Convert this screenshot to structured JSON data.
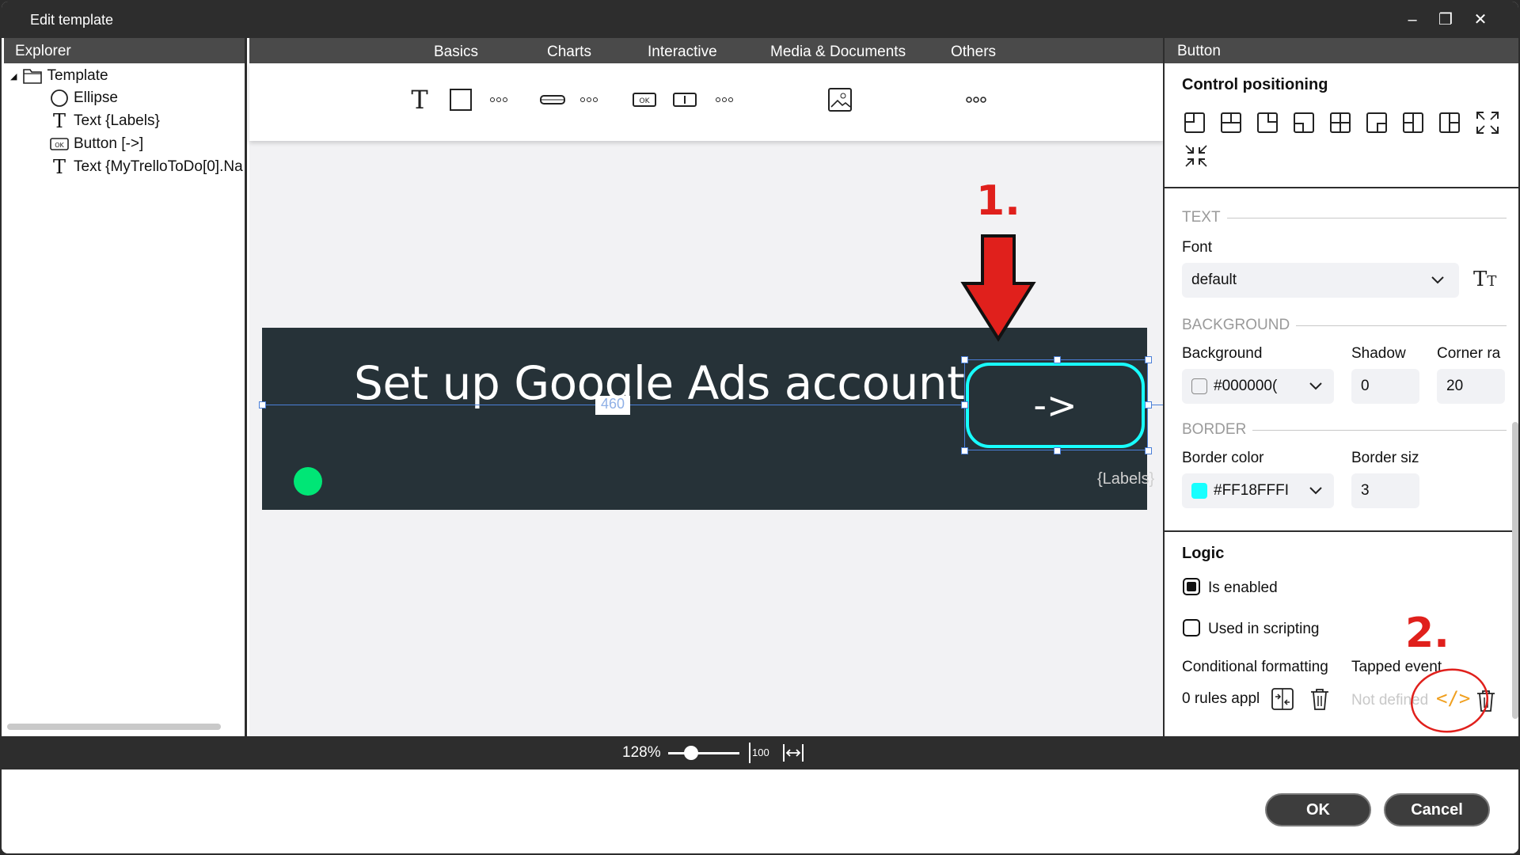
{
  "window": {
    "title": "Edit template",
    "minimize_icon": "minimize-icon",
    "restore_icon": "restore-icon",
    "close_icon": "close-icon"
  },
  "explorer": {
    "header": "Explorer",
    "items": [
      {
        "label": "Template",
        "icon": "folder-icon"
      },
      {
        "label": "Ellipse",
        "icon": "ellipse-icon"
      },
      {
        "label": "Text {Labels}",
        "icon": "text-icon"
      },
      {
        "label": "Button [->]",
        "icon": "button-ok-icon"
      },
      {
        "label": "Text {MyTrelloToDo[0].Na",
        "icon": "text-icon"
      }
    ]
  },
  "toolbox": {
    "tabs": [
      "Basics",
      "Charts",
      "Interactive",
      "Media & Documents",
      "Others"
    ]
  },
  "canvas": {
    "item_text": "Set up Google Ads account",
    "labels_text": "{Labels}",
    "button_text": "->",
    "dim_width": "460",
    "dim_top": "20",
    "dim_bottom": "40",
    "accent_color": "#18ffff",
    "card_color": "#263238",
    "dot_color": "#00e676"
  },
  "zoom": {
    "value": "128%",
    "reset_label": "100"
  },
  "props": {
    "header": "Button",
    "positioning_title": "Control positioning",
    "text_cat": "TEXT",
    "font_label": "Font",
    "font_value": "default",
    "background_cat": "BACKGROUND",
    "background_label": "Background",
    "background_value": "#000000(",
    "shadow_label": "Shadow",
    "shadow_value": "0",
    "corner_label": "Corner ra",
    "corner_value": "20",
    "border_cat": "BORDER",
    "border_color_label": "Border color",
    "border_color_value": "#FF18FFFI",
    "border_size_label": "Border siz",
    "border_size_value": "3",
    "logic_title": "Logic",
    "is_enabled_label": "Is enabled",
    "is_enabled": true,
    "used_in_scripting_label": "Used in scripting",
    "used_in_scripting": false,
    "cond_format_label": "Conditional formatting",
    "cond_format_value": "0 rules appl",
    "tapped_event_label": "Tapped event",
    "tapped_event_value": "Not defined"
  },
  "annotations": {
    "step1": "1.",
    "step2": "2."
  },
  "footer": {
    "ok_label": "OK",
    "cancel_label": "Cancel"
  }
}
